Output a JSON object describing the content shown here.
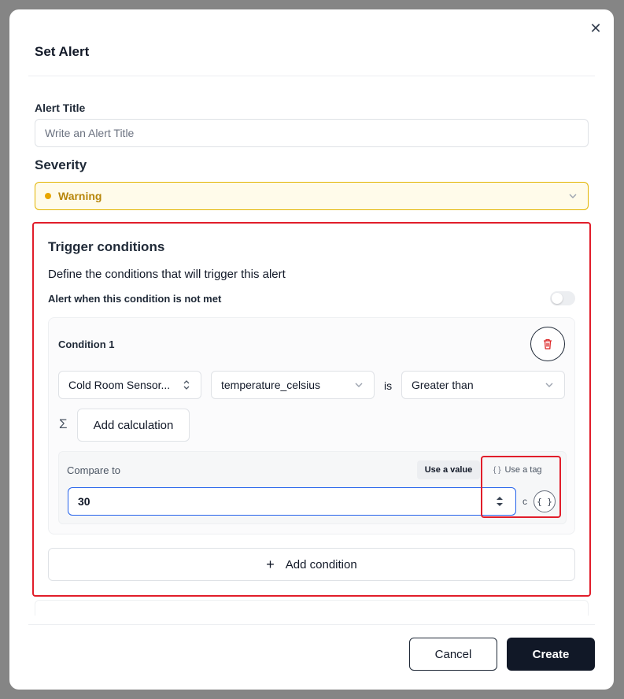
{
  "dialog": {
    "title": "Set Alert",
    "close_icon": "close-icon"
  },
  "alert_title": {
    "label": "Alert Title",
    "placeholder": "Write an Alert Title",
    "value": ""
  },
  "severity": {
    "label": "Severity",
    "value": "Warning",
    "color": "#e8a600"
  },
  "trigger": {
    "title": "Trigger conditions",
    "description": "Define the conditions that will trigger this alert",
    "not_met_label": "Alert when this condition is not met",
    "not_met_enabled": false
  },
  "condition": {
    "label": "Condition 1",
    "source": "Cold Room Sensor...",
    "field": "temperature_celsius",
    "operator_prefix": "is",
    "operator": "Greater than",
    "add_calculation": "Add calculation",
    "compare_label": "Compare to",
    "use_value": "Use a value",
    "use_tag": "Use a tag",
    "compare_value": "30",
    "unit": "c",
    "tag_symbol": "{ }"
  },
  "add_condition": "Add condition",
  "footer": {
    "cancel": "Cancel",
    "create": "Create"
  },
  "colors": {
    "highlight": "#e11d2a",
    "primary": "#111827",
    "warning": "#e8a600",
    "delete": "#dc2626"
  }
}
